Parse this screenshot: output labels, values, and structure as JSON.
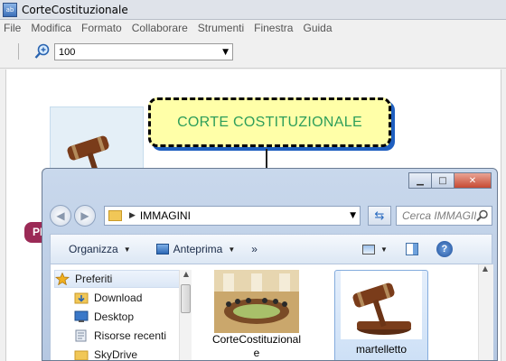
{
  "window": {
    "title": "CorteCostituzionale"
  },
  "menu": [
    "File",
    "Modifica",
    "Formato",
    "Collaborare",
    "Strumenti",
    "Finestra",
    "Guida"
  ],
  "toolbar": {
    "zoom_value": "100"
  },
  "map": {
    "central_node": "CORTE COSTITUZIONALE",
    "side_node": "PREFERITI",
    "colors": {
      "central_fill": "#ffffa8",
      "central_text": "#2e9e5a",
      "side_fill": "#9b2a56",
      "shadow": "#1f5fc0"
    }
  },
  "explorer": {
    "address": "IMMAGINI",
    "search_placeholder": "Cerca IMMAGINI",
    "commands": {
      "organize": "Organizza",
      "preview": "Anteprima",
      "more": "»"
    },
    "nav_items": [
      {
        "label": "Preferiti",
        "icon": "star-icon"
      },
      {
        "label": "Download",
        "icon": "download-folder-icon"
      },
      {
        "label": "Desktop",
        "icon": "desktop-icon"
      },
      {
        "label": "Risorse recenti",
        "icon": "recent-places-icon"
      },
      {
        "label": "SkyDrive",
        "icon": "folder-icon"
      }
    ],
    "files": [
      {
        "label": "CorteCostituzionale",
        "thumb": "courtroom-photo",
        "selected": false
      },
      {
        "label": "martelletto",
        "thumb": "gavel-image",
        "selected": true
      }
    ]
  }
}
